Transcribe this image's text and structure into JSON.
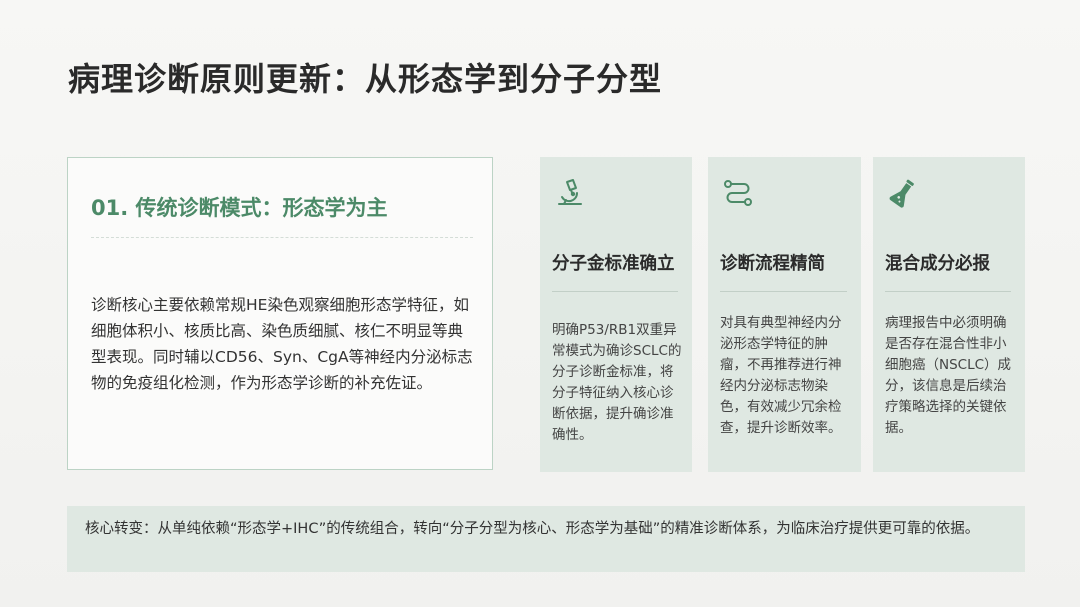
{
  "title": "病理诊断原则更新：从形态学到分子分型",
  "left_card": {
    "heading": "01. 传统诊断模式：形态学为主",
    "body": "诊断核心主要依赖常规HE染色观察细胞形态学特征，如细胞体积小、核质比高、染色质细腻、核仁不明显等典型表现。同时辅以CD56、Syn、CgA等神经内分泌标志物的免疫组化检测，作为形态学诊断的补充佐证。"
  },
  "features": [
    {
      "icon": "microscope-icon",
      "title": "分子金标准确立",
      "text": "明确P53/RB1双重异常模式为确诊SCLC的分子诊断金标准，将分子特征纳入核心诊断依据，提升确诊准确性。"
    },
    {
      "icon": "route-icon",
      "title": "诊断流程精简",
      "text": "对具有典型神经内分泌形态学特征的肿瘤，不再推荐进行神经内分泌标志物染色，有效减少冗余检查，提升诊断效率。"
    },
    {
      "icon": "flask-icon",
      "title": "混合成分必报",
      "text": "病理报告中必须明确是否存在混合性非小细胞癌（NSCLC）成分，该信息是后续治疗策略选择的关键依据。"
    }
  ],
  "footer": {
    "text": "核心转变：从单纯依赖“形态学+IHC”的传统组合，转向“分子分型为核心、形态学为基础”的精准诊断体系，为临床治疗提供更可靠的依据。"
  },
  "colors": {
    "accent": "#4c8a68",
    "card_bg": "#dfe8e2",
    "border": "#bcd3c5"
  }
}
